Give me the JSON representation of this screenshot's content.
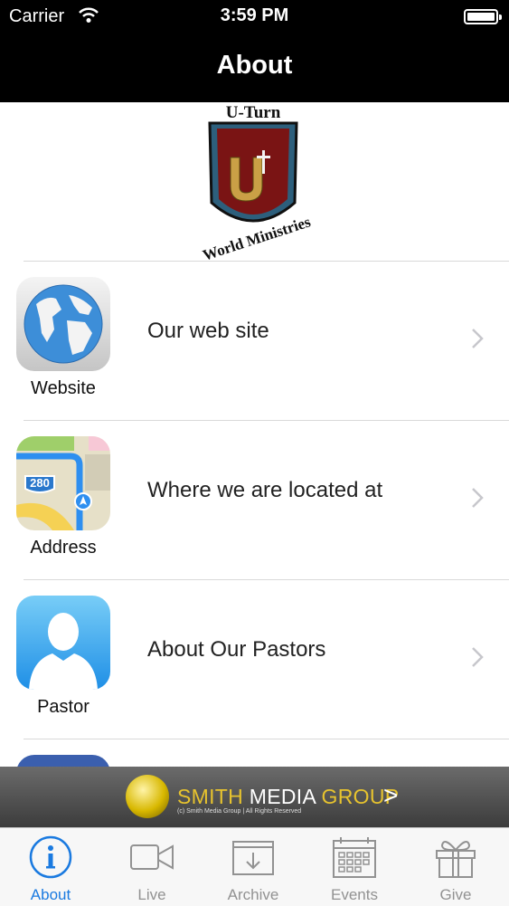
{
  "status_bar": {
    "carrier": "Carrier",
    "time": "3:59 PM"
  },
  "nav": {
    "title": "About"
  },
  "logo": {
    "top_text": "U-Turn",
    "letter": "U",
    "bottom_text": "World Ministries"
  },
  "items": [
    {
      "icon": "globe-icon",
      "label": "Website",
      "description": "Our web site"
    },
    {
      "icon": "map-icon",
      "label": "Address",
      "description": "Where we are located at",
      "badge": "280"
    },
    {
      "icon": "person-icon",
      "label": "Pastor",
      "description": "About Our Pastors"
    }
  ],
  "banner": {
    "name_part1": "SMITH",
    "name_part2": "MEDIA",
    "name_part3": "GROUP",
    "arrow": ">",
    "rights": "(c) Smith Media Group | All Rights Reserved"
  },
  "tabs": [
    {
      "label": "About",
      "icon": "info-icon",
      "active": true
    },
    {
      "label": "Live",
      "icon": "video-camera-icon",
      "active": false
    },
    {
      "label": "Archive",
      "icon": "archive-box-icon",
      "active": false
    },
    {
      "label": "Events",
      "icon": "calendar-icon",
      "active": false
    },
    {
      "label": "Give",
      "icon": "gift-icon",
      "active": false
    }
  ],
  "colors": {
    "accent": "#1a7ae0",
    "bar_bg": "#000000",
    "banner_gold": "#e7c32e"
  }
}
